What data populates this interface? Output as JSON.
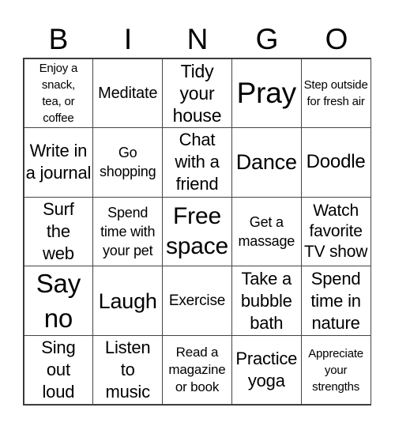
{
  "header": {
    "letters": [
      "B",
      "I",
      "N",
      "G",
      "O"
    ]
  },
  "grid": {
    "rows": [
      [
        "Enjoy a snack, tea, or coffee",
        "Meditate",
        "Tidy your house",
        "Pray",
        "Step outside for fresh air"
      ],
      [
        "Write in a journal",
        "Go shopping",
        "Chat with a friend",
        "Dance",
        "Doodle"
      ],
      [
        "Surf the web",
        "Spend time with your pet",
        "Free space",
        "Get a massage",
        "Watch favorite TV show"
      ],
      [
        "Say no",
        "Laugh",
        "Exercise",
        "Take a bubble bath",
        "Spend time in nature"
      ],
      [
        "Sing out loud",
        "Listen to music",
        "Read a magazine or book",
        "Practice yoga",
        "Appreciate your strengths"
      ]
    ]
  },
  "colors": {
    "border": "#444444",
    "background": "#ffffff",
    "text": "#000000"
  }
}
